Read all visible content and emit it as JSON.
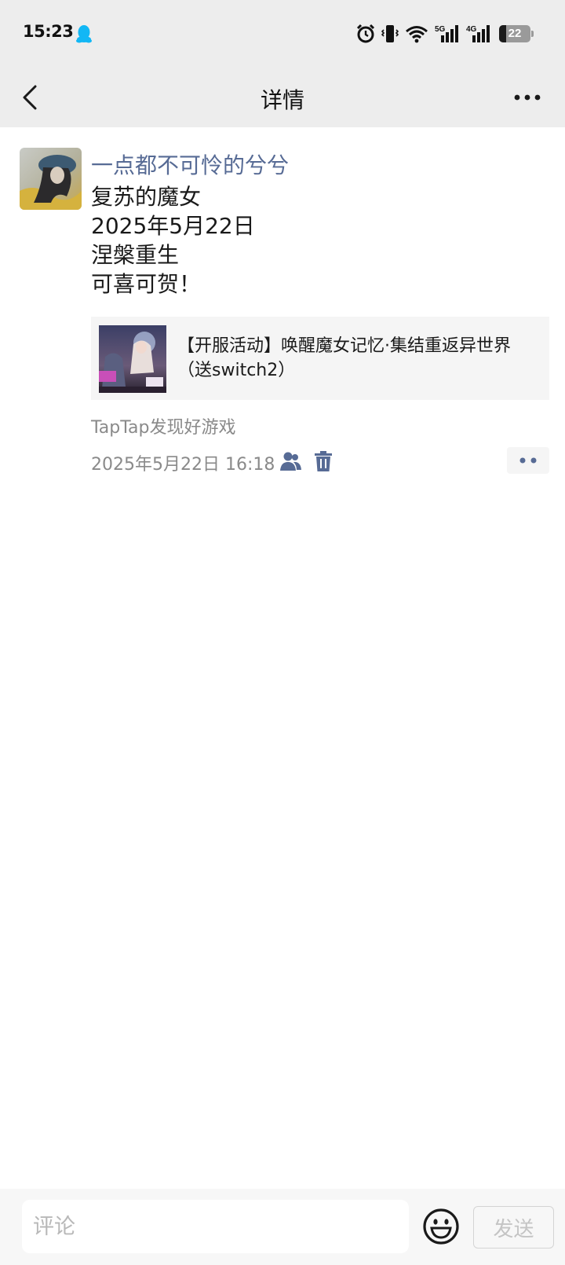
{
  "status_bar": {
    "time": "15:23",
    "net_5g": "5G",
    "net_4g": "4G",
    "battery": "22",
    "icons": [
      "qq-icon",
      "alarm-icon",
      "vibrate-icon",
      "wifi-icon",
      "signal-5g-icon",
      "signal-4g-icon",
      "battery-icon"
    ]
  },
  "nav": {
    "title": "详情",
    "back_icon": "chevron-left-icon",
    "more_icon": "more-dots-icon"
  },
  "post": {
    "username": "一点都不可怜的兮兮",
    "lines": [
      "复苏的魔女",
      "2025年5月22日",
      "涅槃重生",
      "可喜可贺！"
    ],
    "share": {
      "title": "【开服活动】唤醒魔女记忆·集结重返异世界（送switch2）"
    },
    "source": "TapTap发现好游戏",
    "time": "2025年5月22日 16:18",
    "visibility_icon": "friends-visibility-icon",
    "delete_icon": "trash-icon",
    "action_icon": "two-dots-icon"
  },
  "comment_bar": {
    "placeholder": "评论",
    "send_label": "发送",
    "emoji_icon": "emoji-smile-icon"
  },
  "colors": {
    "bar_bg": "#ededed",
    "username": "#576b95",
    "meta_text": "#8a8a8a",
    "card_bg": "#f5f5f5"
  }
}
